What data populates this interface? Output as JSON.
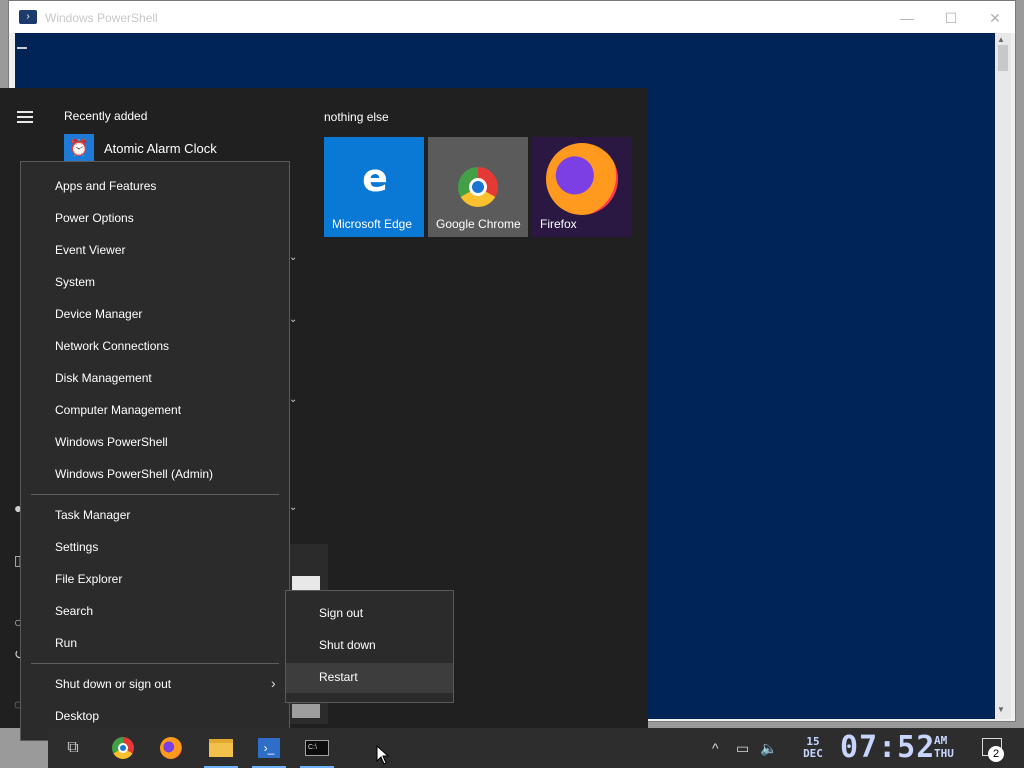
{
  "powershell_window": {
    "title": "Windows PowerShell",
    "minimize_glyph": "—",
    "maximize_glyph": "☐",
    "close_glyph": "✕",
    "console_bg": "#012456"
  },
  "start_menu": {
    "recently_added_label": "Recently added",
    "recent_app": "Atomic Alarm Clock",
    "group_title": "nothing else",
    "tiles": [
      {
        "label": "Microsoft Edge",
        "color": "#0a79d6",
        "icon": "edge-icon"
      },
      {
        "label": "Google Chrome",
        "color": "#5b5b5b",
        "icon": "chrome-icon"
      },
      {
        "label": "Firefox",
        "color": "#2a1842",
        "icon": "firefox-icon"
      }
    ]
  },
  "winx_menu": {
    "items": [
      "Apps and Features",
      "Power Options",
      "Event Viewer",
      "System",
      "Device Manager",
      "Network Connections",
      "Disk Management",
      "Computer Management",
      "Windows PowerShell",
      "Windows PowerShell (Admin)",
      "Task Manager",
      "Settings",
      "File Explorer",
      "Search",
      "Run",
      "Shut down or sign out",
      "Desktop"
    ]
  },
  "shutdown_submenu": {
    "items": [
      "Sign out",
      "Shut down",
      "Restart"
    ],
    "highlighted": "Restart"
  },
  "taskbar": {
    "apps": [
      "task-view",
      "chrome",
      "firefox",
      "file-explorer",
      "powershell",
      "cmd"
    ],
    "clock": {
      "day": "15",
      "month": "DEC",
      "time": "07:52",
      "ampm": "AM",
      "weekday": "THU"
    },
    "notification_count": "2"
  }
}
